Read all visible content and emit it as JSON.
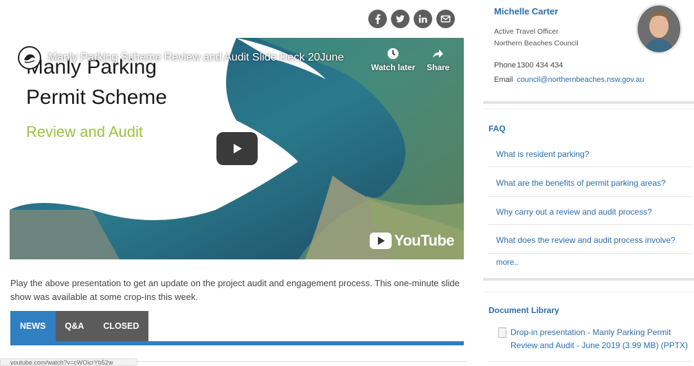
{
  "share": {
    "icons": [
      "facebook-icon",
      "twitter-icon",
      "linkedin-icon",
      "email-icon"
    ]
  },
  "video": {
    "title": "Manly Parking Scheme Review and Audit Slide Deck 20June",
    "watch_later_label": "Watch later",
    "share_label": "Share",
    "slide_line1": "Manly Parking",
    "slide_line2": "Permit Scheme",
    "slide_subtitle": "Review and Audit",
    "youtube_label": "YouTube"
  },
  "description": "Play the above presentation to get an update on the project audit and engagement process. This one-minute slide show was available at some crop-ins this week.",
  "tabs": [
    {
      "label": "NEWS",
      "active": true
    },
    {
      "label": "Q&A",
      "active": false
    },
    {
      "label": "CLOSED",
      "active": false
    }
  ],
  "status_url": "youtube.com/watch?v=cWOicrYb52w",
  "contact": {
    "name": "Michelle Carter",
    "role": "Active Travel Officer",
    "org": "Northern Beaches Council",
    "phone_label": "Phone",
    "phone": "1300 434 434",
    "email_label": "Email",
    "email": "council@northernbeaches.nsw.gov.au"
  },
  "faq": {
    "title": "FAQ",
    "items": [
      "What is resident parking?",
      "What are the benefits of permit parking areas?",
      "Why carry out a review and audit process?",
      "What does the review and audit process involve?"
    ],
    "more_label": "more.."
  },
  "documents": {
    "title": "Document Library",
    "items": [
      "Drop-in presentation - Manly Parking Permit Review and Audit - June 2019 (3.99 MB) (PPTX)"
    ]
  },
  "colors": {
    "accent": "#2f7fc2",
    "link": "#2a6fae",
    "tab_inactive": "#5b5b5b",
    "share_icon_bg": "#5d5d5d"
  }
}
